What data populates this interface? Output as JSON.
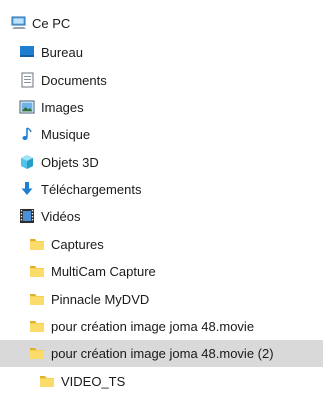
{
  "tree": {
    "root": {
      "label": "Ce PC",
      "icon": "computer-icon"
    },
    "items": [
      {
        "label": "Bureau",
        "icon": "desktop-icon"
      },
      {
        "label": "Documents",
        "icon": "documents-icon"
      },
      {
        "label": "Images",
        "icon": "pictures-icon"
      },
      {
        "label": "Musique",
        "icon": "music-icon"
      },
      {
        "label": "Objets 3D",
        "icon": "objects-3d-icon"
      },
      {
        "label": "Téléchargements",
        "icon": "downloads-icon"
      },
      {
        "label": "Vidéos",
        "icon": "videos-icon"
      }
    ],
    "video_children": [
      {
        "label": "Captures",
        "icon": "folder-icon"
      },
      {
        "label": "MultiCam Capture",
        "icon": "folder-icon"
      },
      {
        "label": "Pinnacle MyDVD",
        "icon": "folder-icon"
      },
      {
        "label": "pour création image joma 48.movie",
        "icon": "folder-icon"
      },
      {
        "label": "pour création image joma 48.movie (2)",
        "icon": "folder-icon",
        "selected": true
      }
    ],
    "nested_child": {
      "label": "VIDEO_TS",
      "icon": "folder-icon"
    }
  },
  "colors": {
    "selection": "#d9d9d9",
    "folder": "#f8d050",
    "folder_dark": "#e0b030",
    "accent_blue": "#1e7fd2"
  }
}
